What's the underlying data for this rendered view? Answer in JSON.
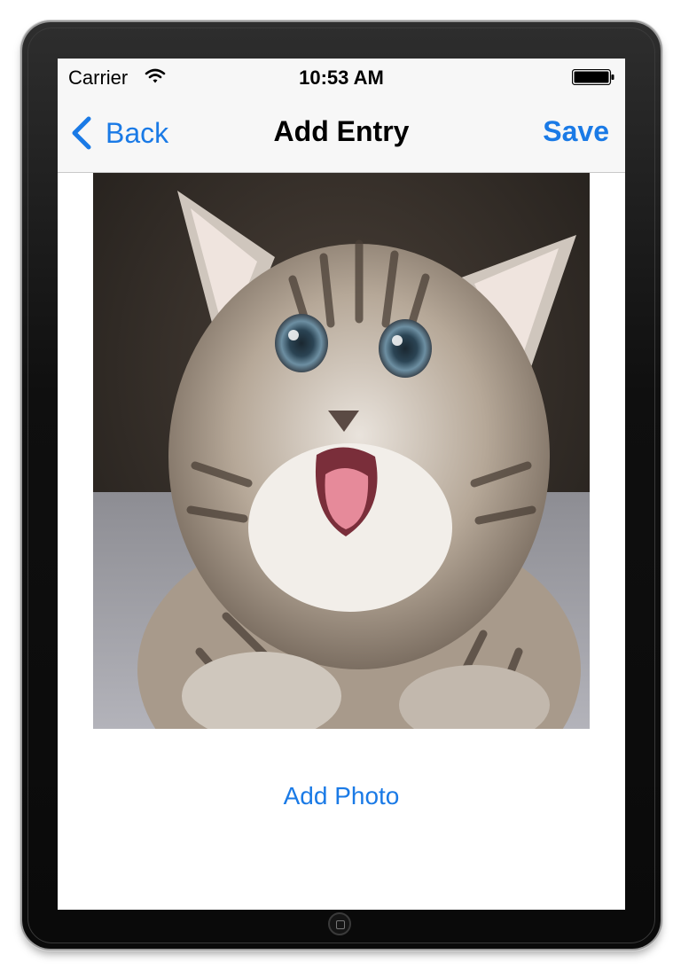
{
  "status_bar": {
    "carrier": "Carrier",
    "time": "10:53 AM",
    "wifi_icon": "wifi-icon",
    "battery_icon": "battery-icon"
  },
  "nav_bar": {
    "back_label": "Back",
    "title": "Add Entry",
    "save_label": "Save",
    "tint_color": "#1a7ae6"
  },
  "photo": {
    "alt": "kitten photo"
  },
  "add_photo_label": "Add Photo"
}
